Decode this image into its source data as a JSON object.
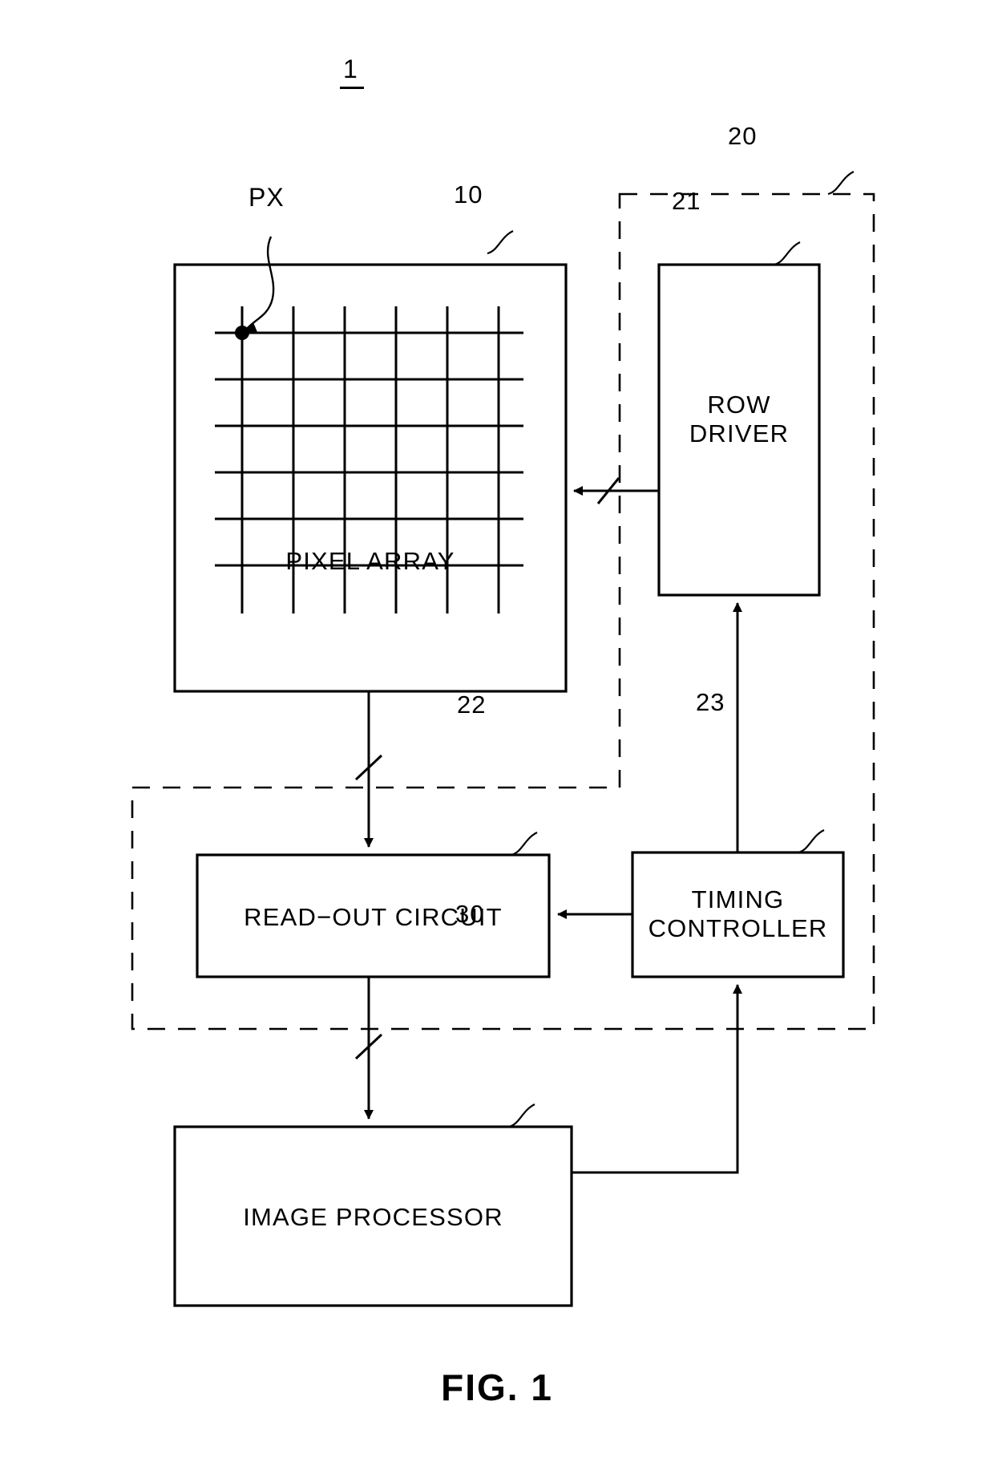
{
  "figure": {
    "title_number": "1",
    "caption": "FIG. 1"
  },
  "blocks": [
    {
      "id": "pixel-array",
      "ref": "10",
      "label": "PIXEL ARRAY",
      "lines": [
        "PIXEL ARRAY"
      ]
    },
    {
      "id": "row-driver",
      "ref": "21",
      "label": "ROW DRIVER",
      "lines": [
        "ROW",
        "DRIVER"
      ]
    },
    {
      "id": "read-out-circuit",
      "ref": "22",
      "label": "READ-OUT CIRCUIT",
      "lines": [
        "READ−OUT CIRCUIT"
      ]
    },
    {
      "id": "timing-controller",
      "ref": "23",
      "label": "TIMING CONTROLLER",
      "lines": [
        "TIMING",
        "CONTROLLER"
      ]
    },
    {
      "id": "image-processor",
      "ref": "30",
      "label": "IMAGE PROCESSOR",
      "lines": [
        "IMAGE PROCESSOR"
      ]
    }
  ],
  "groups": [
    {
      "id": "controller-group",
      "ref": "20"
    }
  ],
  "annotations": [
    {
      "id": "pixel-callout",
      "label": "PX"
    }
  ],
  "colors": {
    "line": "#000000",
    "background": "#ffffff"
  }
}
